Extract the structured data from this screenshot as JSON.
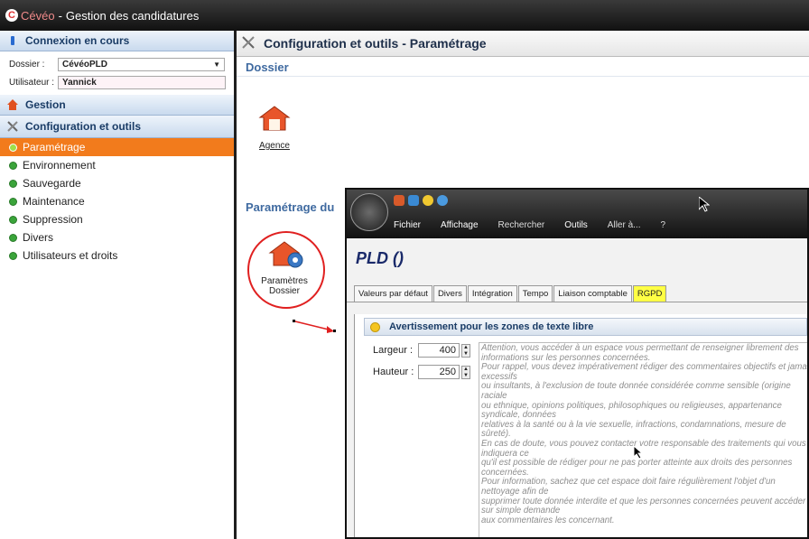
{
  "titlebar": {
    "app": "Cévéo",
    "sep": "-",
    "title": "Gestion des candidatures"
  },
  "sidebar": {
    "connexion_header": "Connexion en cours",
    "dossier_label": "Dossier :",
    "dossier_value": "CévéoPLD",
    "utilisateur_label": "Utilisateur :",
    "utilisateur_value": "Yannick",
    "gestion_header": "Gestion",
    "config_header": "Configuration et outils",
    "items": [
      {
        "label": "Paramétrage",
        "active": true
      },
      {
        "label": "Environnement"
      },
      {
        "label": "Sauvegarde"
      },
      {
        "label": "Maintenance"
      },
      {
        "label": "Suppression"
      },
      {
        "label": "Divers"
      },
      {
        "label": "Utilisateurs et droits"
      }
    ]
  },
  "main": {
    "header": "Configuration et outils - Paramétrage",
    "dossier_section": "Dossier",
    "agence_label": "Agence",
    "param_section": "Paramétrage du",
    "param_dossier_label_1": "Paramètres",
    "param_dossier_label_2": "Dossier"
  },
  "popup": {
    "menu": [
      "Fichier",
      "Affichage",
      "Rechercher",
      "Outils",
      "Aller à...",
      "?"
    ],
    "title": "PLD ()",
    "tabs": [
      "Valeurs par défaut",
      "Divers",
      "Intégration",
      "Tempo",
      "Liaison comptable",
      "RGPD"
    ],
    "active_tab": "RGPD",
    "warning_header": "Avertissement pour les zones de texte libre",
    "largeur_label": "Largeur :",
    "largeur_value": "400",
    "hauteur_label": "Hauteur :",
    "hauteur_value": "250",
    "text_lines": [
      "Attention, vous accéder à un espace vous permettant de renseigner librement des",
      "informations sur les personnes concernées.",
      "Pour rappel, vous devez impérativement rédiger des commentaires objectifs et jamais",
      "excessifs",
      "ou insultants, à l'exclusion de toute donnée considérée comme sensible (origine",
      "raciale",
      "ou ethnique, opinions politiques, philosophiques ou religieuses, appartenance",
      "syndicale, données",
      "relatives à la santé ou à la vie sexuelle, infractions, condamnations, mesure de",
      "sûreté).",
      "En cas de doute, vous pouvez contacter votre responsable des traitements qui vous",
      "indiquera ce",
      "qu'il est possible de rédiger pour ne pas porter atteinte aux droits des personnes",
      "concernées.",
      "Pour information, sachez que cet espace doit faire régulièrement l'objet d'un",
      "nettoyage afin de",
      "supprimer toute donnée interdite et que les personnes concernées peuvent accéder",
      "sur simple demande",
      "aux commentaires les concernant."
    ]
  },
  "colors": {
    "active_menu": "#f27b1c",
    "rgpd_tab": "#ffff44",
    "annotation": "#e02020"
  }
}
